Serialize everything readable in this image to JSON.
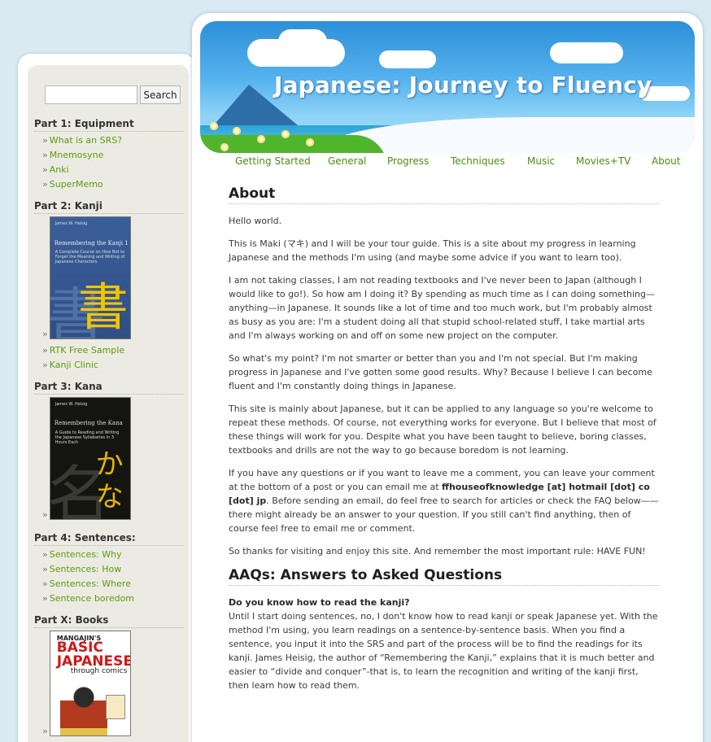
{
  "search": {
    "placeholder": "",
    "button_label": "Search"
  },
  "sidebar": {
    "sections": [
      {
        "heading": "Part 1: Equipment",
        "links": [
          "What is an SRS?",
          "Mnemosyne",
          "Anki",
          "SuperMemo"
        ]
      },
      {
        "heading": "Part 2: Kanji",
        "book": {
          "title": "Remembering the Kanji 1",
          "subtitle": "A Complete Course on How Not to Forget the Meaning and Writing of Japanese Characters",
          "author": "James W. Heisig",
          "glyph": "書",
          "ghost": "書"
        },
        "links": [
          "RTK Free Sample",
          "Kanji Clinic"
        ]
      },
      {
        "heading": "Part 3: Kana",
        "book": {
          "title": "Remembering the Kana",
          "subtitle": "A Guide to Reading and Writing the Japanese Syllabaries in 3 Hours Each",
          "author": "James W. Heisig",
          "glyph": "かな",
          "ghost": "名"
        }
      },
      {
        "heading": "Part 4: Sentences:",
        "links": [
          "Sentences: Why",
          "Sentences: How",
          "Sentences: Where",
          "Sentence boredom"
        ]
      },
      {
        "heading": "Part X: Books",
        "book": {
          "top": "MANGAJIN'S",
          "title": "BASIC JAPANESE",
          "subtitle": "through comics"
        }
      }
    ],
    "bullet": "»"
  },
  "header": {
    "title": "Japanese: Journey to Fluency"
  },
  "nav": [
    "Getting Started",
    "General",
    "Progress",
    "Techniques",
    "Music",
    "Movies+TV",
    "About"
  ],
  "content": {
    "about_title": "About",
    "p1": "Hello world.",
    "p2": "This is Maki (マキ) and I will be your tour guide. This is a site about my progress in learning Japanese and the methods I'm using (and maybe some advice if you want to learn too).",
    "p3": "I am not taking classes, I am not reading textbooks and I've never been to Japan (although I would like to go!). So how am I doing it? By spending as much time as I can doing something—anything—in Japanese. It sounds like a lot of time and too much work, but I'm probably almost as busy as you are: I'm a student doing all that stupid school-related stuff, I take martial arts and I'm always working on and off on some new project on the computer.",
    "p4": "So what's my point? I'm not smarter or better than you and I'm not special. But I'm making progress in Japanese and I've gotten some good results. Why? Because I believe I can become fluent and I'm constantly doing things in Japanese.",
    "p5": "This site is mainly about Japanese, but it can be applied to any language so you're welcome to repeat these methods. Of course, not everything works for everyone. But I believe that most of these things will work for you. Despite what you have been taught to believe, boring classes, textbooks and drills are not the way to go because boredom is not learning.",
    "p6_a": "If you have any questions or if you want to leave me a comment, you can leave your comment at the bottom of a post or you can email me at ",
    "p6_email": "ffhouseofknowledge [at] hotmail [dot] co [dot] jp",
    "p6_b": ". Before sending an email, do feel free to search for articles or check the FAQ below——there might already be an answer to your question. If you still can't find anything, then of course feel free to email me or comment.",
    "p7": "So thanks for visiting and enjoy this site. And remember the most important rule: HAVE FUN!",
    "aaq_title": "AAQs: Answers to Asked Questions",
    "q1": "Do you know how to read the kanji?",
    "a1": "Until I start doing sentences, no, I don't know how to read kanji or speak Japanese yet. With the method I'm using, you learn readings on a sentence-by-sentence basis. When you find a sentence, you input it into the SRS and part of the process will be to find the readings for its kanji. James Heisig, the author of “Remembering the Kanji,” explains that it is much better and easier to “divide and conquer”-that is, to learn the recognition and writing of the kanji first, then learn how to read them."
  },
  "colors": {
    "link": "#5d9a10",
    "sidebar_bg": "#ecebe3",
    "page_bg": "#d9eaf2"
  }
}
